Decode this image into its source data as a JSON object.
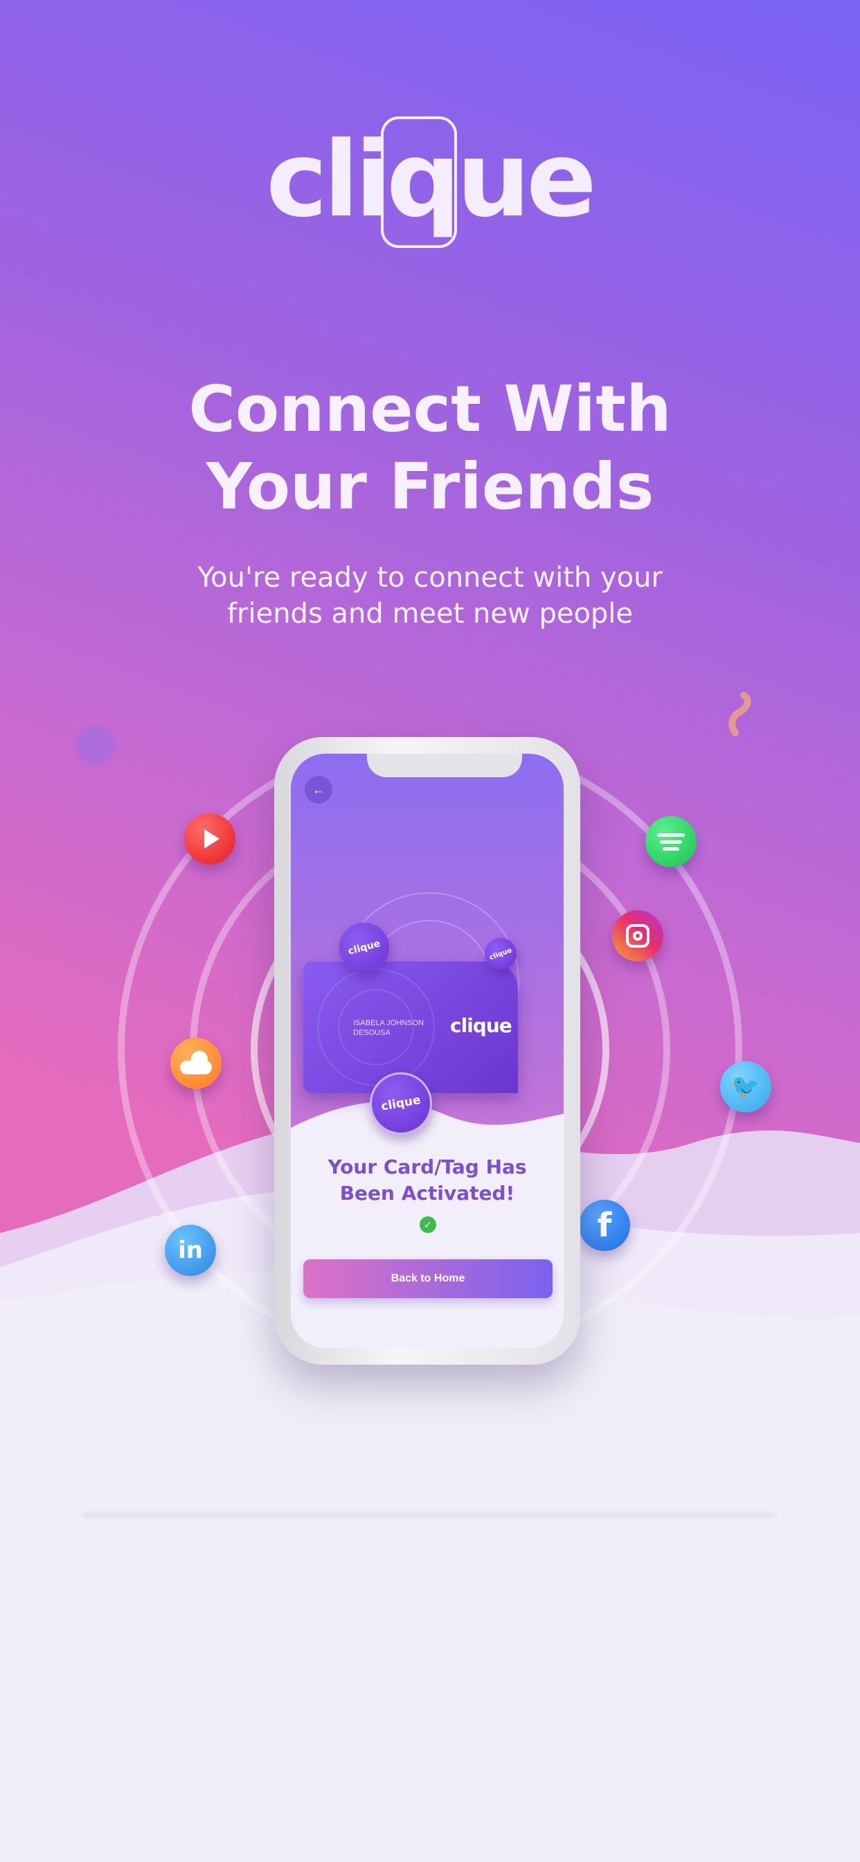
{
  "logo": {
    "text": "clique"
  },
  "headline": {
    "line1": "Connect With",
    "line2": "Your Friends"
  },
  "subline": {
    "line1": "You're ready to connect with your",
    "line2": "friends and meet new people"
  },
  "socials": [
    "youtube-icon",
    "spotify-icon",
    "instagram-icon",
    "soundcloud-icon",
    "twitter-icon",
    "facebook-icon",
    "linkedin-icon"
  ],
  "phone": {
    "card_holder": "ISABELA JOHNSON DESOUSA",
    "card_logo": "clique",
    "tag_label": "clique",
    "status_title": "Your Card/Tag Has Been Activated!",
    "status_line1": "Your Card/Tag Has",
    "status_line2": "Been Activated!",
    "cta_label": "Back to Home"
  },
  "colors": {
    "gradient_top": "#7a63f5",
    "gradient_bottom": "#e56bbd",
    "accent_purple": "#7a4fd0",
    "success_green": "#3dbb4c"
  }
}
